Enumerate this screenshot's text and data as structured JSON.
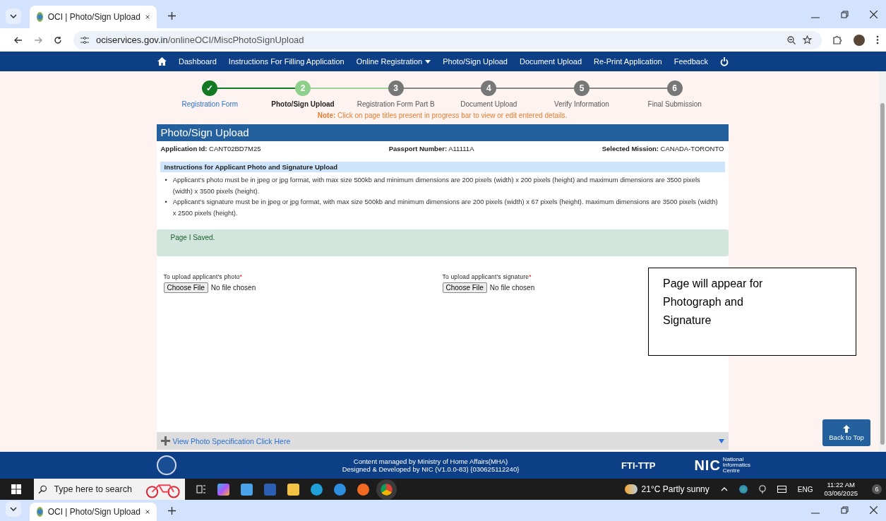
{
  "browser": {
    "tab_title": "OCI | Photo/Sign Upload",
    "url_host": "ociservices.gov.in",
    "url_path": "/onlineOCI/MiscPhotoSignUpload"
  },
  "nav": {
    "items": [
      {
        "label": "Dashboard",
        "dropdown": false
      },
      {
        "label": "Instructions For Filling Application",
        "dropdown": false
      },
      {
        "label": "Online Registration",
        "dropdown": true
      },
      {
        "label": "Photo/Sign Upload",
        "dropdown": false
      },
      {
        "label": "Document Upload",
        "dropdown": false
      },
      {
        "label": "Re-Print Application",
        "dropdown": false
      },
      {
        "label": "Feedback",
        "dropdown": false
      }
    ]
  },
  "steps": [
    {
      "badge": "✓",
      "label": "Registration Form",
      "done": true,
      "selected": false
    },
    {
      "badge": "2",
      "label": "Photo/Sign Upload",
      "done": false,
      "selected": true
    },
    {
      "badge": "3",
      "label": "Registration Form Part B",
      "done": false,
      "selected": false
    },
    {
      "badge": "4",
      "label": "Document Upload",
      "done": false,
      "selected": false
    },
    {
      "badge": "5",
      "label": "Verify Information",
      "done": false,
      "selected": false
    },
    {
      "badge": "6",
      "label": "Final Submission",
      "done": false,
      "selected": false
    }
  ],
  "note": {
    "label": "Note:",
    "text": "Click on page titles present in progress bar to view or edit entered details."
  },
  "panel": {
    "title": "Photo/Sign Upload",
    "fields": [
      {
        "label": "Application Id:",
        "value": "CANT02BD7M25"
      },
      {
        "label": "Passport Number:",
        "value": "A11111A"
      },
      {
        "label": "Selected Mission:",
        "value": "CANADA-TORONTO"
      }
    ],
    "bullet": "•",
    "instructions_title": "Instructions for Applicant Photo and Signature Upload",
    "instructions": [
      "Applicant's photo must be in jpeg or jpg format, with max size 500kb and minimum dimensions are 200 pixels (width) x 200 pixels (height) and maximum dimensions are 3500 pixels (width) x 3500 pixels (height).",
      "Applicant's signature must be in jpeg or jpg format, with max size 500kb and minimum dimensions are 200 pixels (width) x 67 pixels (height). maximum dimensions are 3500 pixels (width) x 2500 pixels (height)."
    ],
    "message": "Page I Saved.",
    "uploads": [
      {
        "label": "To upload applicant's photo",
        "required_mark": "*",
        "button": "Choose File",
        "status": "No file chosen"
      },
      {
        "label": "To upload applicant's signature",
        "required_mark": "*",
        "button": "Choose File",
        "status": "No file chosen"
      }
    ],
    "spec_link": "View Photo Specification Click Here"
  },
  "back_to_top": "Back to Top",
  "footer": {
    "lines": [
      "Content managed by Ministry of Home Affairs(MHA)",
      "Designed & Developed by NIC (V1.0.0-83) {030625112240}"
    ],
    "fti_logo": "FTI-TTP",
    "nic_logo": "NIC",
    "nic_subtitle": "National Informatics Centre"
  },
  "callout": "Page will appear for Photograph and Signature",
  "taskbar": {
    "search_placeholder": "Type here to search",
    "weather": "21°C Partly sunny",
    "language": "ENG",
    "time": "11:22 AM",
    "date": "03/06/2025",
    "notifications": "6"
  },
  "second_tab": {
    "title": "OCI | Photo/Sign Upload"
  }
}
